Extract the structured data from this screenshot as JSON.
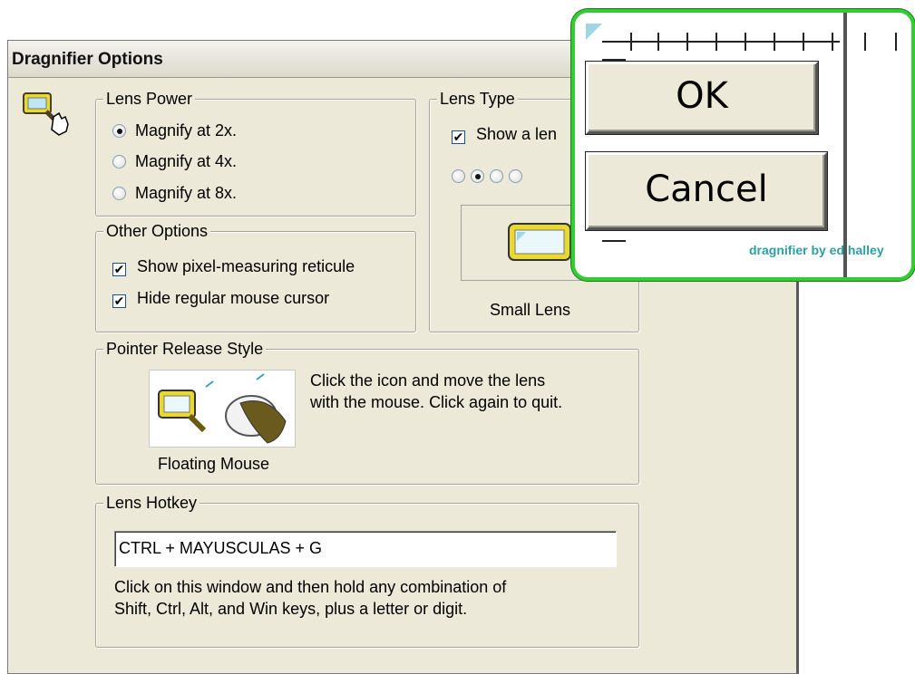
{
  "window": {
    "title": "Dragnifier Options"
  },
  "lens_power": {
    "legend": "Lens Power",
    "options": [
      {
        "label": "Magnify at 2x.",
        "selected": true
      },
      {
        "label": "Magnify at 4x.",
        "selected": false
      },
      {
        "label": "Magnify at 8x.",
        "selected": false
      }
    ]
  },
  "other_options": {
    "legend": "Other Options",
    "items": [
      {
        "label": "Show pixel-measuring reticule",
        "checked": true
      },
      {
        "label": "Hide regular mouse cursor",
        "checked": true
      }
    ]
  },
  "lens_type": {
    "legend": "Lens Type",
    "show_lens_label": "Show a len",
    "show_lens_checked": true,
    "style_radios_selected_index": 1,
    "preview_caption": "Small Lens"
  },
  "pointer_release": {
    "legend": "Pointer Release Style",
    "description_line1": "Click the icon and move the lens",
    "description_line2": "with the mouse. Click again to quit.",
    "caption": "Floating Mouse"
  },
  "hotkey": {
    "legend": "Lens Hotkey",
    "value": "CTRL + MAYUSCULAS + G",
    "help_line1": "Click on this window and then hold any combination of",
    "help_line2": "Shift, Ctrl, Alt, and Win keys, plus a letter or digit."
  },
  "overlay": {
    "ok_label": "OK",
    "cancel_label": "Cancel",
    "credit": "dragnifier by ed halley"
  },
  "colors": {
    "overlay_border": "#33cc33",
    "dialog_bg": "#ece9d8",
    "lens_yellow": "#e8d830",
    "credit_text": "#2aa0a0"
  },
  "icons": [
    "magnifier-hand-icon",
    "lens-preview-icon",
    "floating-mouse-icon"
  ]
}
